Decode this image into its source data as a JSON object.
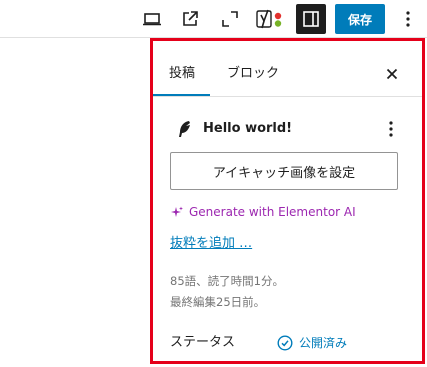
{
  "toolbar": {
    "preview_icon": "laptop-icon",
    "view_icon": "external-link-icon",
    "fullscreen_icon": "fullscreen-icon",
    "yoast_icon": "yoast-icon",
    "sidebar_icon": "sidebar-toggle-icon",
    "save_label": "保存",
    "options_icon": "vertical-ellipsis-icon",
    "accent_color": "#007cba"
  },
  "sidebar": {
    "tabs": [
      {
        "label": "投稿",
        "active": true
      },
      {
        "label": "ブロック",
        "active": false
      }
    ],
    "close_icon": "close-icon",
    "post": {
      "icon": "feather-icon",
      "title": "Hello world!",
      "menu_icon": "vertical-ellipsis-icon"
    },
    "featured_image_label": "アイキャッチ画像を設定",
    "elementor_label": "Generate with Elementor AI",
    "excerpt_link": "抜粋を追加 …",
    "meta": {
      "word_count": "85語、読了時間1分。",
      "last_edited": "最終編集25日前。"
    },
    "status": {
      "label": "ステータス",
      "value": "公開済み",
      "icon": "check-circle-icon"
    },
    "highlight_color": "#e5001a"
  }
}
